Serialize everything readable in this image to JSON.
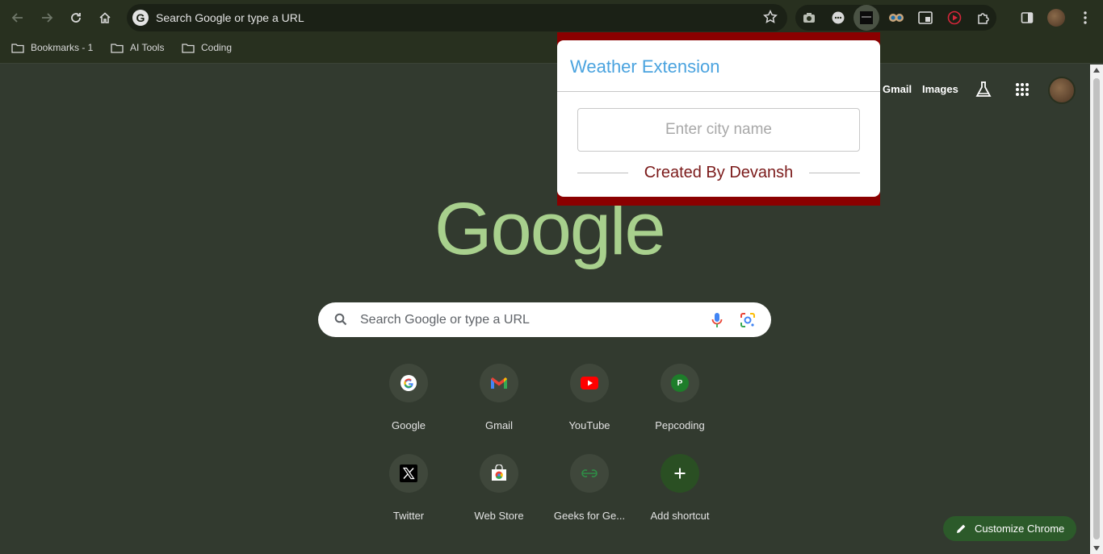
{
  "toolbar": {
    "omnibox_text": "Search Google or type a URL"
  },
  "bookmarks": [
    {
      "label": "Bookmarks - 1"
    },
    {
      "label": "AI Tools"
    },
    {
      "label": "Coding"
    }
  ],
  "header": {
    "gmail": "Gmail",
    "images": "Images"
  },
  "logo": "Google",
  "search": {
    "placeholder": "Search Google or type a URL"
  },
  "shortcuts": [
    {
      "label": "Google",
      "icon": "google-icon"
    },
    {
      "label": "Gmail",
      "icon": "gmail-icon"
    },
    {
      "label": "YouTube",
      "icon": "youtube-icon"
    },
    {
      "label": "Pepcoding",
      "icon": "pepcoding-icon",
      "letter": "P"
    },
    {
      "label": "Twitter",
      "icon": "x-icon"
    },
    {
      "label": "Web Store",
      "icon": "web-store-icon"
    },
    {
      "label": "Geeks for Ge...",
      "icon": "gfg-icon"
    },
    {
      "label": "Add shortcut",
      "icon": "plus-icon"
    }
  ],
  "customize": {
    "label": "Customize Chrome"
  },
  "popup": {
    "title": "Weather Extension",
    "input_placeholder": "Enter city name",
    "credit": "Created By Devansh"
  },
  "colors": {
    "page_bg": "#323a2f",
    "toolbar_bg": "#28301f",
    "logo": "#a8d08d",
    "popup_border": "#8b0000",
    "popup_title": "#4aa3df",
    "credit": "#7b1a1a",
    "customize_bg": "#2c5a2a"
  }
}
